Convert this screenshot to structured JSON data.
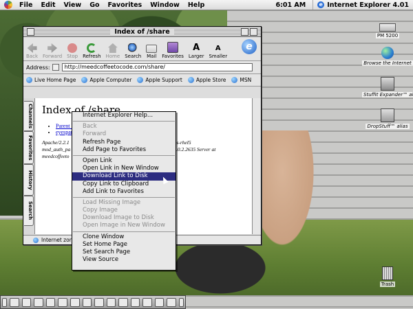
{
  "menubar": {
    "items": [
      "File",
      "Edit",
      "View",
      "Go",
      "Favorites",
      "Window",
      "Help"
    ],
    "clock": "6:01 AM",
    "app_name": "Internet Explorer 4.01"
  },
  "window": {
    "title": "Index of /share",
    "toolbar": [
      {
        "label": "Back",
        "icon": "back-arrow-icon",
        "disabled": true
      },
      {
        "label": "Forward",
        "icon": "forward-arrow-icon",
        "disabled": true
      },
      {
        "label": "Stop",
        "icon": "stop-icon",
        "disabled": true
      },
      {
        "label": "Refresh",
        "icon": "refresh-icon",
        "disabled": false
      },
      {
        "label": "Home",
        "icon": "home-icon",
        "disabled": true
      },
      {
        "label": "Search",
        "icon": "search-icon",
        "disabled": false
      },
      {
        "label": "Mail",
        "icon": "mail-icon",
        "disabled": false
      },
      {
        "label": "Favorites",
        "icon": "favorites-icon",
        "disabled": false
      },
      {
        "label": "Larger",
        "icon": "larger-font-icon",
        "disabled": false
      },
      {
        "label": "Smaller",
        "icon": "smaller-font-icon",
        "disabled": false
      }
    ],
    "address_label": "Address:",
    "address_value": "http://meedcoffeetocode.com/share/",
    "links": [
      "Live Home Page",
      "Apple Computer",
      "Apple Support",
      "Apple Store",
      "MSN"
    ],
    "side_tabs": [
      "Channels",
      "Favorites",
      "History",
      "Search"
    ],
    "page": {
      "heading": "Index of /share",
      "list": [
        "Parent Directory",
        "eyespark.jpg"
      ],
      "address_line_1": "Apache/2.2.1",
      "address_line_2": "mod_auth_pa",
      "address_line_3": "meedcoffeeto",
      "address_tail_1": "lips-rhel5",
      "address_tail_2": "5.0.2.2635 Server at"
    },
    "status_text": "Internet zone"
  },
  "context_menu": {
    "items": [
      {
        "label": "Internet Explorer Help...",
        "enabled": true
      },
      {
        "sep": true
      },
      {
        "label": "Back",
        "enabled": false
      },
      {
        "label": "Forward",
        "enabled": false
      },
      {
        "label": "Refresh Page",
        "enabled": true
      },
      {
        "label": "Add Page to Favorites",
        "enabled": true
      },
      {
        "sep": true
      },
      {
        "label": "Open Link",
        "enabled": true
      },
      {
        "label": "Open Link in New Window",
        "enabled": true
      },
      {
        "label": "Download Link to Disk",
        "enabled": true,
        "highlighted": true
      },
      {
        "label": "Copy Link to Clipboard",
        "enabled": true
      },
      {
        "label": "Add Link to Favorites",
        "enabled": true
      },
      {
        "sep": true
      },
      {
        "label": "Load Missing Image",
        "enabled": false
      },
      {
        "label": "Copy Image",
        "enabled": false
      },
      {
        "label": "Download Image to Disk",
        "enabled": false
      },
      {
        "label": "Open Image in New Window",
        "enabled": false
      },
      {
        "sep": true
      },
      {
        "label": "Clone Window",
        "enabled": true
      },
      {
        "label": "Set Home Page",
        "enabled": true
      },
      {
        "label": "Set Search Page",
        "enabled": true
      },
      {
        "label": "View Source",
        "enabled": true
      }
    ]
  },
  "desktop_icons": [
    {
      "label": "PM 5200",
      "icon": "hard-drive-icon"
    },
    {
      "label": "Browse the Internet",
      "icon": "globe-icon"
    },
    {
      "label": "StuffIt Expander™ alias",
      "icon": "stuffit-expander-icon"
    },
    {
      "label": "DropStuff™ alias",
      "icon": "dropstuff-icon"
    },
    {
      "label": "Trash",
      "icon": "trash-icon"
    }
  ],
  "colors": {
    "highlight": "#2c2c80",
    "link": "#0000cc"
  }
}
